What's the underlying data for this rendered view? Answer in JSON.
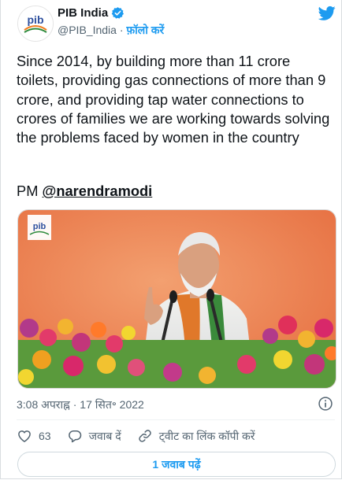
{
  "account": {
    "name": "PIB India",
    "handle": "@PIB_India",
    "separator": "·",
    "follow_label": "फ़ॉलो करें",
    "avatar_text": "pib"
  },
  "tweet": {
    "text": "Since 2014, by building more than 11 crore toilets, providing gas connections of more than 9 crore, and providing tap water connections to crores of families we are working towards solving the problems faced by women in the country",
    "pm_prefix": "PM ",
    "mention": "@narendramodi"
  },
  "media": {
    "logo_text": "pib"
  },
  "meta": {
    "timestamp": "3:08 अपराह्न · 17 सित॰ 2022"
  },
  "actions": {
    "like_count": "63",
    "reply_label": "जवाब दें",
    "copy_link_label": "ट्वीट का लिंक कॉपी करें"
  },
  "read_replies_label": "1 जवाब पढ़ें",
  "colors": {
    "accent": "#1d9bf0",
    "text": "#0f1419",
    "muted": "#536471"
  }
}
